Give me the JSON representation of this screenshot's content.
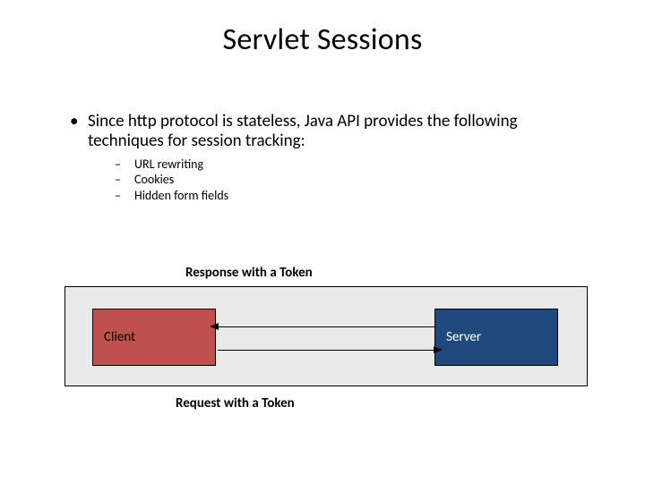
{
  "title": "Servlet Sessions",
  "bullet_main": "Since http protocol is stateless, Java API provides the following techniques for session tracking:",
  "techniques": {
    "t0": "URL rewriting",
    "t1": "Cookies",
    "t2": "Hidden form fields"
  },
  "diagram": {
    "client": "Client",
    "server": "Server",
    "response_label": "Response with a Token",
    "request_label": "Request with a Token"
  }
}
